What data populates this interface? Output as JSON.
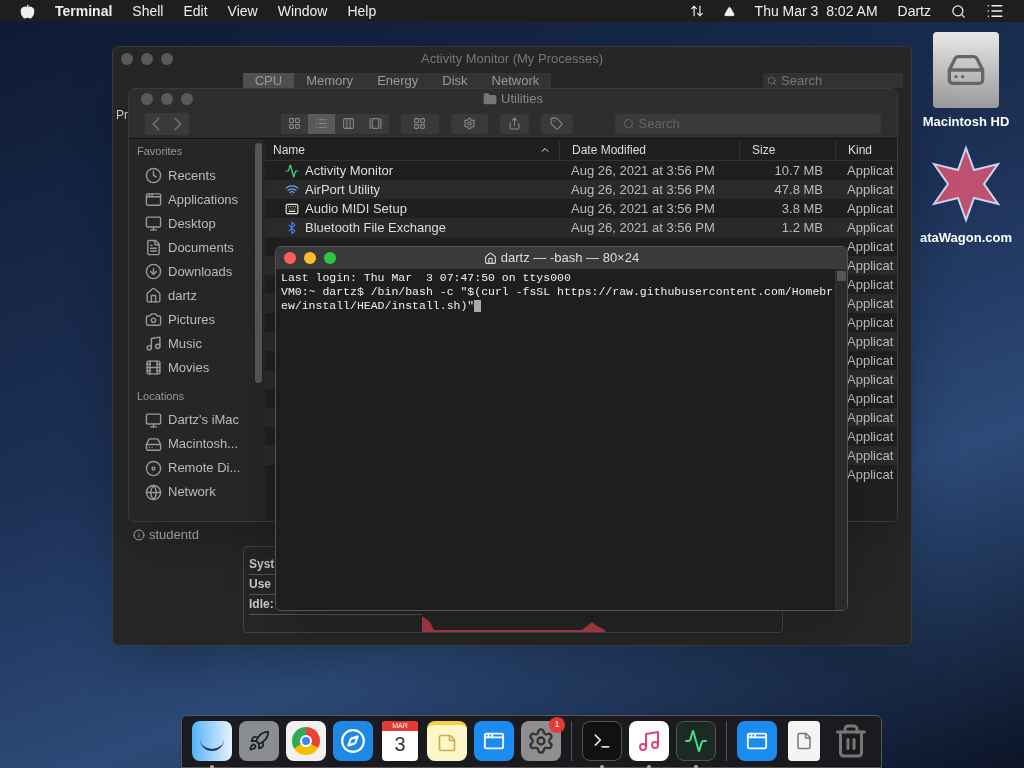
{
  "menu_bar": {
    "app": "Terminal",
    "menus": [
      "Shell",
      "Edit",
      "View",
      "Window",
      "Help"
    ],
    "clock": "Thu Mar 3  8:02 AM",
    "user": "Dartz"
  },
  "desktop_icons": [
    {
      "kind": "drive",
      "label": "Macintosh HD"
    },
    {
      "kind": "logo",
      "label": "ataWagon.com"
    }
  ],
  "activity_monitor": {
    "title": "Activity Monitor (My Processes)",
    "tabs": [
      {
        "label": "CPU",
        "selected": true
      },
      {
        "label": "Memory",
        "selected": false
      },
      {
        "label": "Energy",
        "selected": false
      },
      {
        "label": "Disk",
        "selected": false
      },
      {
        "label": "Network",
        "selected": false
      }
    ],
    "search": {
      "placeholder": "Search"
    },
    "column_1": "Pr",
    "process": "studentd",
    "stats": [
      "Syst",
      "Use",
      "Idle:"
    ]
  },
  "finder": {
    "title": "Utilities",
    "views": [
      {
        "kind": "icons",
        "selected": false
      },
      {
        "kind": "list",
        "selected": true
      },
      {
        "kind": "columns",
        "selected": false
      },
      {
        "kind": "gallery",
        "selected": false
      }
    ],
    "search": {
      "placeholder": "Search"
    },
    "sidebar": [
      {
        "heading": "Favorites",
        "items": [
          {
            "kind": "recents",
            "label": "Recents"
          },
          {
            "kind": "applications",
            "label": "Applications"
          },
          {
            "kind": "desktop",
            "label": "Desktop"
          },
          {
            "kind": "documents",
            "label": "Documents"
          },
          {
            "kind": "downloads",
            "label": "Downloads"
          },
          {
            "kind": "home",
            "label": "dartz"
          },
          {
            "kind": "pictures",
            "label": "Pictures"
          },
          {
            "kind": "music",
            "label": "Music"
          },
          {
            "kind": "movies",
            "label": "Movies"
          }
        ]
      },
      {
        "heading": "Locations",
        "items": [
          {
            "kind": "computer",
            "label": "Dartz's iMac"
          },
          {
            "kind": "disk",
            "label": "Macintosh..."
          },
          {
            "kind": "disc",
            "label": "Remote Di..."
          },
          {
            "kind": "network",
            "label": "Network"
          }
        ]
      }
    ],
    "columns": [
      "Name",
      "Date Modified",
      "Size",
      "Kind"
    ],
    "rows": [
      {
        "kind": "activity",
        "name": "Activity Monitor",
        "date": "Aug 26, 2021 at 3:56 PM",
        "size": "10.7 MB",
        "type": "Applicat"
      },
      {
        "kind": "wifi",
        "name": "AirPort Utility",
        "date": "Aug 26, 2021 at 3:56 PM",
        "size": "47.8 MB",
        "type": "Applicat"
      },
      {
        "kind": "piano",
        "name": "Audio MIDI Setup",
        "date": "Aug 26, 2021 at 3:56 PM",
        "size": "3.8 MB",
        "type": "Applicat"
      },
      {
        "kind": "bluetooth",
        "name": "Bluetooth File Exchange",
        "date": "Aug 26, 2021 at 3:56 PM",
        "size": "1.2 MB",
        "type": "Applicat"
      },
      {
        "type": "Applicat"
      },
      {
        "type": "Applicat"
      },
      {
        "type": "Applicat"
      },
      {
        "type": "Applicat"
      },
      {
        "type": "Applicat"
      },
      {
        "type": "Applicat"
      },
      {
        "type": "Applicat"
      },
      {
        "type": "Applicat"
      },
      {
        "type": "Applicat"
      },
      {
        "type": "Applicat"
      },
      {
        "type": "Applicat"
      },
      {
        "type": "Applicat"
      },
      {
        "type": "Applicat"
      }
    ]
  },
  "terminal": {
    "title": "dartz — -bash — 80×24",
    "lines": [
      "Last login: Thu Mar  3 07:47:50 on ttys000",
      "VM0:~ dartz$ /bin/bash -c \"$(curl -fsSL https://raw.githubusercontent.com/Homebr",
      "ew/install/HEAD/install.sh)\""
    ]
  },
  "dock": [
    [
      {
        "kind": "finder",
        "running": true
      },
      {
        "kind": "launchpad",
        "running": false
      },
      {
        "kind": "chrome",
        "running": false
      },
      {
        "kind": "safari",
        "running": false
      },
      {
        "kind": "calendar",
        "running": false,
        "month": "MAR",
        "day": "3"
      },
      {
        "kind": "notes",
        "running": false
      },
      {
        "kind": "appstore",
        "running": false
      },
      {
        "kind": "settings",
        "running": false,
        "badge": "1"
      }
    ],
    [
      {
        "kind": "terminal",
        "running": true
      },
      {
        "kind": "music",
        "running": true
      },
      {
        "kind": "activity",
        "running": true
      }
    ],
    [
      {
        "kind": "appstore",
        "running": false
      },
      {
        "kind": "document",
        "running": false
      },
      {
        "kind": "trash",
        "running": false
      }
    ]
  ]
}
